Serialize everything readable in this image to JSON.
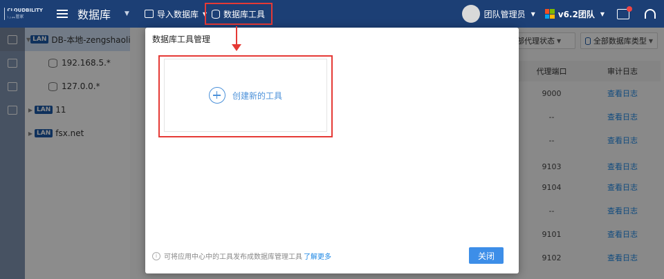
{
  "header": {
    "logo_line1": "CLOUDBILITY",
    "logo_line2": "行云管家",
    "page_title": "数据库",
    "import_label": "导入数据库",
    "db_tool_label": "数据库工具",
    "user_name": "团队管理员",
    "version_label": "v6.2团队",
    "icons": [
      "menu-icon",
      "import-icon",
      "db-tool-icon",
      "windows-icon",
      "message-icon",
      "headset-icon"
    ]
  },
  "sidebar": {
    "items": [
      {
        "name": "DB-本地-zengshaoli...",
        "badge": "LAN",
        "expanded": true
      },
      {
        "name": "192.168.5.*"
      },
      {
        "name": "127.0.0.*"
      },
      {
        "name": "11",
        "badge": "LAN"
      },
      {
        "name": "fsx.net",
        "badge": "LAN"
      }
    ]
  },
  "filters": {
    "proxy_status": "部代理状态",
    "db_type": "全部数据库类型"
  },
  "table": {
    "headers": [
      "代理端口",
      "审计日志"
    ],
    "rows": [
      {
        "port": "9000",
        "log": "查看日志"
      },
      {
        "port": "--",
        "log": "查看日志"
      },
      {
        "port": "--",
        "log": "查看日志"
      },
      {
        "port": "9103",
        "log": "查看日志"
      },
      {
        "port": "9104",
        "log": "查看日志"
      },
      {
        "port": "--",
        "log": "查看日志"
      },
      {
        "port": "9101",
        "log": "查看日志"
      },
      {
        "port": "9102",
        "log": "查看日志"
      }
    ]
  },
  "modal": {
    "title": "数据库工具管理",
    "create_label": "创建新的工具",
    "footer_text": "可将应用中心中的工具发布成数据库管理工具",
    "learn_more": "了解更多",
    "close_label": "关闭"
  },
  "colors": {
    "header_bg": "#1c3f75",
    "accent": "#3d8ee8",
    "highlight": "#e53935",
    "link": "#1e88e5"
  }
}
